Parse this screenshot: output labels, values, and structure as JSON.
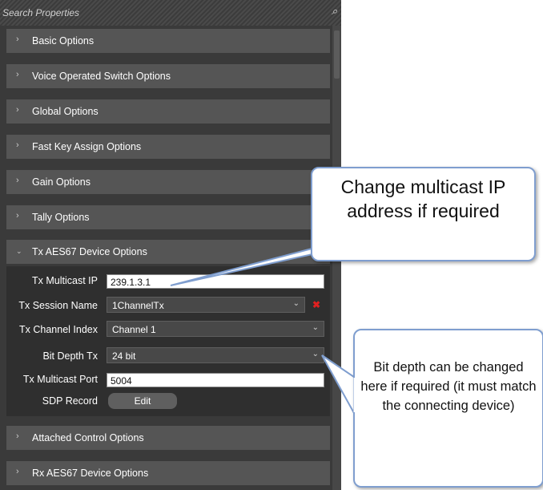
{
  "search": {
    "placeholder": "Search Properties"
  },
  "sections": [
    {
      "label": "Basic Options",
      "expanded": false
    },
    {
      "label": "Voice Operated Switch Options",
      "expanded": false
    },
    {
      "label": "Global Options",
      "expanded": false
    },
    {
      "label": "Fast Key Assign Options",
      "expanded": false
    },
    {
      "label": "Gain Options",
      "expanded": false
    },
    {
      "label": "Tally Options",
      "expanded": false
    },
    {
      "label": "Tx AES67 Device Options",
      "expanded": true
    },
    {
      "label": "Attached Control Options",
      "expanded": false
    },
    {
      "label": "Rx AES67 Device Options",
      "expanded": false
    }
  ],
  "tx": {
    "multicast_ip_label": "Tx Multicast IP",
    "multicast_ip_value": "239.1.3.1",
    "session_name_label": "Tx Session Name",
    "session_name_value": "1ChannelTx",
    "channel_index_label": "Tx Channel Index",
    "channel_index_value": "Channel 1",
    "bit_depth_label": "Bit Depth Tx",
    "bit_depth_value": "24 bit",
    "multicast_port_label": "Tx Multicast Port",
    "multicast_port_value": "5004",
    "sdp_record_label": "SDP Record",
    "edit_label": "Edit"
  },
  "icons": {
    "collapsed": "chevron-right-icon",
    "expanded": "chevron-down-icon",
    "dropdown": "chevron-down-icon",
    "clear": "close-icon",
    "search": "magnifier-icon"
  },
  "callouts": {
    "ip": "Change multicast IP address if required",
    "bit_depth": "Bit depth can be changed here if required (it must match the connecting device)"
  },
  "colors": {
    "panel": "#3a3a3a",
    "header": "#555555",
    "callout_border": "#7f9ecf",
    "clear_x": "#e02020"
  }
}
